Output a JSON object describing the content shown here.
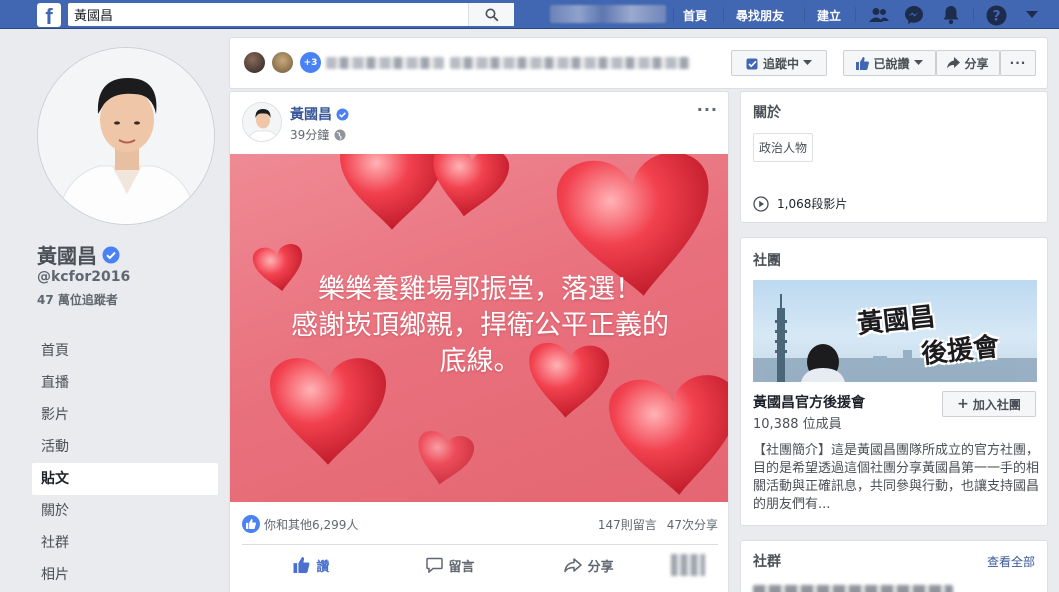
{
  "topbar": {
    "search_value": "黃國昌",
    "nav": [
      "首頁",
      "尋找朋友",
      "建立"
    ],
    "icons": [
      "friends-icon",
      "messenger-icon",
      "notifications-icon",
      "help-icon",
      "account-menu-icon"
    ]
  },
  "profile": {
    "name": "黃國昌",
    "handle": "@kcfor2016",
    "followers": "47 萬位追蹤者"
  },
  "leftnav": {
    "items": [
      "首頁",
      "直播",
      "影片",
      "活動",
      "貼文",
      "關於",
      "社群",
      "相片"
    ],
    "active": "貼文"
  },
  "actionbar": {
    "plus_count": "+3",
    "follow_label": "追蹤中",
    "liked_label": "已說讚",
    "share_label": "分享",
    "more_label": "···"
  },
  "post": {
    "author": "黃國昌",
    "time": "39分鐘",
    "image_text_line1": "樂樂養雞場郭振堂，落選！",
    "image_text_line2": "感謝崁頂鄉親，捍衛公平正義的",
    "image_text_line3": "底線。",
    "reactions_text": "你和其他6,299人",
    "comments_count": "147則留言",
    "shares_count": "47次分享",
    "actions": {
      "like": "讚",
      "comment": "留言",
      "share": "分享"
    }
  },
  "about": {
    "title": "關於",
    "category": "政治人物",
    "videos": "1,068段影片"
  },
  "groups": {
    "title": "社團",
    "banner_text_1": "黃國昌",
    "banner_text_2": "後援會",
    "group_name": "黃國昌官方後援會",
    "members": "10,388 位成員",
    "join_label": "加入社團",
    "description": "【社團簡介】這是黃國昌團隊所成立的官方社團，目的是希望透過這個社團分享黃國昌第一一手的相關活動與正確訊息，共同參與行動，也讓支持國昌的朋友們有..."
  },
  "community": {
    "title": "社群",
    "see_all": "查看全部"
  },
  "colors": {
    "brand": "#4267b2",
    "link": "#385898",
    "verified": "#4a82f5",
    "post_bg": "#e8707c"
  }
}
